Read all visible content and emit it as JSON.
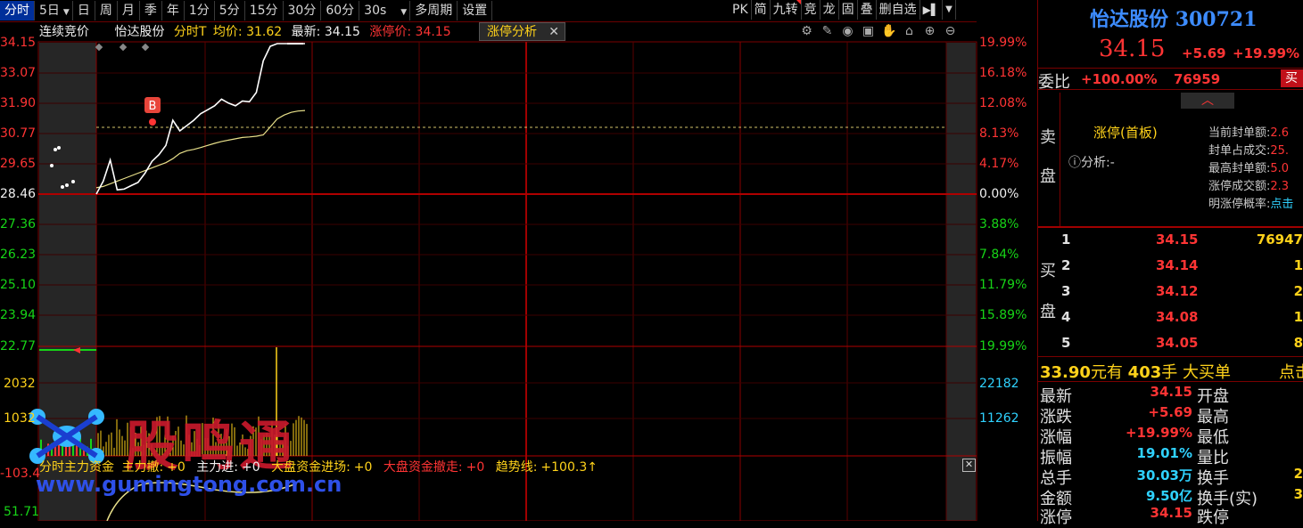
{
  "toolbar": {
    "periods": [
      "分时",
      "5日",
      "日",
      "周",
      "月",
      "季",
      "年",
      "1分",
      "5分",
      "15分",
      "30分",
      "60分",
      "30s",
      "多周期",
      "设置"
    ],
    "right_items": [
      "PK",
      "简",
      "九转",
      "竞",
      "龙",
      "固",
      "叠",
      "删自选"
    ]
  },
  "infobar": {
    "auction": "连续竞价",
    "stock": "怡达股份",
    "mode": "分时T",
    "avg_label": "均价:",
    "avg_value": "31.62",
    "latest_label": "最新:",
    "latest_value": "34.15",
    "limit_label": "涨停价:",
    "limit_value": "34.15",
    "tab_label": "涨停分析"
  },
  "price_axis": {
    "left": [
      "34.15",
      "33.07",
      "31.90",
      "30.77",
      "29.65",
      "28.46",
      "27.36",
      "26.23",
      "25.10",
      "23.94",
      "22.77"
    ],
    "right": [
      "19.99%",
      "16.18%",
      "12.08%",
      "8.13%",
      "4.17%",
      "0.00%",
      "3.88%",
      "7.84%",
      "11.79%",
      "15.89%",
      "19.99%"
    ]
  },
  "volume_axis": {
    "left": [
      "2032",
      "1032"
    ],
    "right": [
      "22182",
      "11262"
    ]
  },
  "lower_axis": {
    "left": [
      "-103.4",
      "51.71"
    ]
  },
  "buy_marker": "B",
  "watermark": {
    "text": "股鸣通",
    "url": "www.gumingtong.com.cn"
  },
  "fund_line": {
    "title": "分时主力资金",
    "items": [
      {
        "label": "主力撤:",
        "value": "+0"
      },
      {
        "label": "主力进:",
        "value": "+0"
      },
      {
        "label": "大盘资金进场:",
        "value": "+0"
      },
      {
        "label": "大盘资金撤走:",
        "value": "+0"
      },
      {
        "label": "趋势线:",
        "value": "+100.3↑"
      }
    ]
  },
  "chart_data": {
    "type": "line",
    "price_series": {
      "name": "",
      "x": [
        0,
        1,
        2,
        3,
        4,
        5,
        6,
        7,
        8,
        9,
        10,
        11,
        12,
        13,
        14,
        15,
        16,
        17,
        18,
        19,
        20,
        21,
        22,
        23,
        24,
        25,
        26,
        27,
        28,
        29,
        30
      ],
      "values": [
        28.46,
        28.95,
        29.75,
        28.62,
        28.65,
        28.78,
        28.9,
        29.25,
        29.7,
        29.95,
        30.3,
        31.25,
        30.85,
        31.05,
        31.25,
        31.5,
        31.65,
        31.8,
        32.05,
        31.9,
        31.8,
        31.98,
        31.95,
        32.3,
        33.5,
        34.05,
        34.15,
        34.15,
        34.15,
        34.15,
        34.15
      ]
    },
    "avg_series": {
      "name": "",
      "values": [
        28.7,
        28.75,
        28.85,
        28.95,
        29.05,
        29.15,
        29.25,
        29.35,
        29.45,
        29.55,
        29.65,
        29.8,
        30.0,
        30.1,
        30.15,
        30.22,
        30.3,
        30.38,
        30.45,
        30.5,
        30.55,
        30.6,
        30.62,
        30.65,
        30.7,
        31.0,
        31.3,
        31.45,
        31.55,
        31.6,
        31.62
      ]
    },
    "ylim": [
      22.77,
      34.15
    ],
    "prev_close": 28.46
  },
  "panel": {
    "name": "怡达股份",
    "code": "300721",
    "price": "34.15",
    "change": "+5.69",
    "change_pct": "+19.99%",
    "weibi_label": "委比",
    "weibi_value": "+100.00%",
    "weibi_num": "76959",
    "buy_btn": "买",
    "sell_label": [
      "卖",
      "盘"
    ],
    "buy_label": [
      "买",
      "盘"
    ],
    "zt_status": "涨停(首板)",
    "analysis_label": "ⓘ分析:-",
    "stats": [
      {
        "k": "当前封单额:",
        "v": "2.6"
      },
      {
        "k": "封单占成交:",
        "v": "25."
      },
      {
        "k": "最高封单额:",
        "v": "5.0"
      },
      {
        "k": "涨停成交额:",
        "v": "2.3"
      },
      {
        "k": "明涨停概率:",
        "v": "点击"
      }
    ],
    "order_book": [
      {
        "lv": "1",
        "price": "34.15",
        "vol": "76947"
      },
      {
        "lv": "2",
        "price": "34.14",
        "vol": "1"
      },
      {
        "lv": "3",
        "price": "34.12",
        "vol": "2"
      },
      {
        "lv": "4",
        "price": "34.08",
        "vol": "1"
      },
      {
        "lv": "5",
        "price": "34.05",
        "vol": "8"
      }
    ],
    "big_order": {
      "price": "33.90",
      "unit": "元有",
      "qty": "403",
      "unit2": "手",
      "label": "大买单",
      "link": "点击"
    },
    "quote": [
      {
        "k": "最新",
        "v": "34.15",
        "k2": "开盘",
        "v2": ""
      },
      {
        "k": "涨跌",
        "v": "+5.69",
        "k2": "最高",
        "v2": ""
      },
      {
        "k": "涨幅",
        "v": "+19.99%",
        "k2": "最低",
        "v2": ""
      },
      {
        "k": "振幅",
        "v": "19.01%",
        "k2": "量比",
        "v2": ""
      },
      {
        "k": "总手",
        "v": "30.03万",
        "k2": "换手",
        "v2": "2"
      },
      {
        "k": "金额",
        "v": "9.50亿",
        "k2": "换手(实)",
        "v2": "3"
      },
      {
        "k": "涨停",
        "v": "34.15",
        "k2": "跌停",
        "v2": ""
      }
    ]
  }
}
